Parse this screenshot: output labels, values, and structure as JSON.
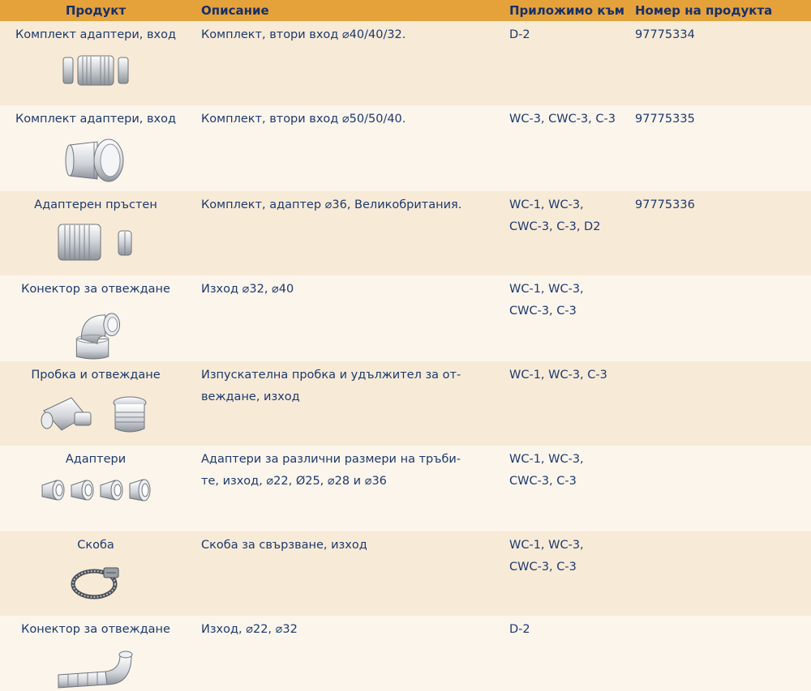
{
  "header": {
    "product": "Продукт",
    "description": "Описание",
    "applicable": "Приложимо към",
    "number": "Номер на продукта"
  },
  "rows": [
    {
      "name": "Комплект адаптери, вход",
      "description": "Комплект, втори вход ⌀40/40/32.",
      "applicable": "D-2",
      "number": "97775334",
      "image": "inlet-adapter-set-small"
    },
    {
      "name": "Комплект адаптери, вход",
      "description": "Комплект, втори вход ⌀50/50/40.",
      "applicable": "WC-3, CWC-3, C-3",
      "number": "97775335",
      "image": "inlet-adapter-large"
    },
    {
      "name": "Адаптерен пръстен",
      "description": "Комплект, адаптер ⌀36, Великобритания.",
      "applicable": "WC-1, WC-3,\nCWC-3, C-3, D2",
      "number": "97775336",
      "image": "adapter-ring"
    },
    {
      "name": "Конектор за отвеждане",
      "description": "Изход ⌀32, ⌀40",
      "applicable": "WC-1, WC-3,\nCWC-3, C-3",
      "number": "",
      "image": "elbow-connector"
    },
    {
      "name": "Пробка и отвеждане",
      "description": "Изпускателна пробка и удължител за от-\nвеждане, изход",
      "applicable": "WC-1, WC-3, C-3",
      "number": "",
      "image": "plug-and-drain"
    },
    {
      "name": "Адаптери",
      "description": "Адаптери за различни размери на тръби-\nте, изход, ⌀22, Ø25, ⌀28 и ⌀36",
      "applicable": "WC-1, WC-3,\nCWC-3, C-3",
      "number": "",
      "image": "four-adapters"
    },
    {
      "name": "Скоба",
      "description": "Скоба за свързване, изход",
      "applicable": "WC-1, WC-3,\nCWC-3, C-3",
      "number": "",
      "image": "hose-clamp"
    },
    {
      "name": "Конектор за отвеждане",
      "description": "Изход, ⌀22, ⌀32",
      "applicable": "D-2",
      "number": "",
      "image": "drain-hose-connector"
    }
  ]
}
